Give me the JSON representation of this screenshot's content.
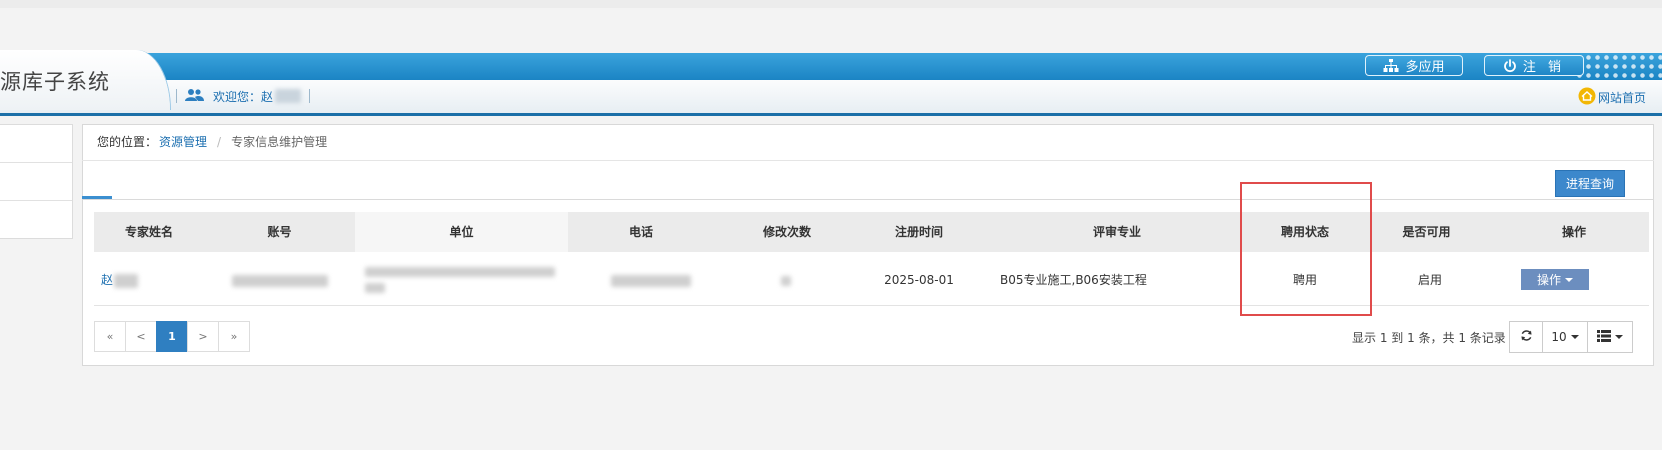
{
  "header": {
    "system_title": "资源库子系统",
    "welcome": "欢迎您：",
    "user_name": "赵",
    "btn_multi_app": "多应用",
    "btn_logout": "注 销",
    "home_link": "网站首页"
  },
  "breadcrumb": {
    "prefix": "您的位置：",
    "level1": "资源管理",
    "separator": "/",
    "current": "专家信息维护管理"
  },
  "toolbar": {
    "query_button": "进程查询"
  },
  "table": {
    "columns": [
      "专家姓名",
      "账号",
      "单位",
      "电话",
      "修改次数",
      "注册时间",
      "评审专业",
      "聘用状态",
      "是否可用",
      "操作"
    ],
    "rows": [
      {
        "name": "赵",
        "reg_date": "2025-08-01",
        "specialty": "B05专业施工,B06安装工程",
        "hire_status": "聘用",
        "enabled": "启用",
        "action": "操作"
      }
    ]
  },
  "pagination": {
    "first": "«",
    "prev": "<",
    "current": "1",
    "next": ">",
    "last": "»",
    "summary": "显示 1 到 1 条，共 1 条记录",
    "page_size": "10"
  },
  "colors": {
    "header_blue": "#1b84c4",
    "primary_button": "#3c88cc",
    "highlight_red": "#e04b4b"
  }
}
